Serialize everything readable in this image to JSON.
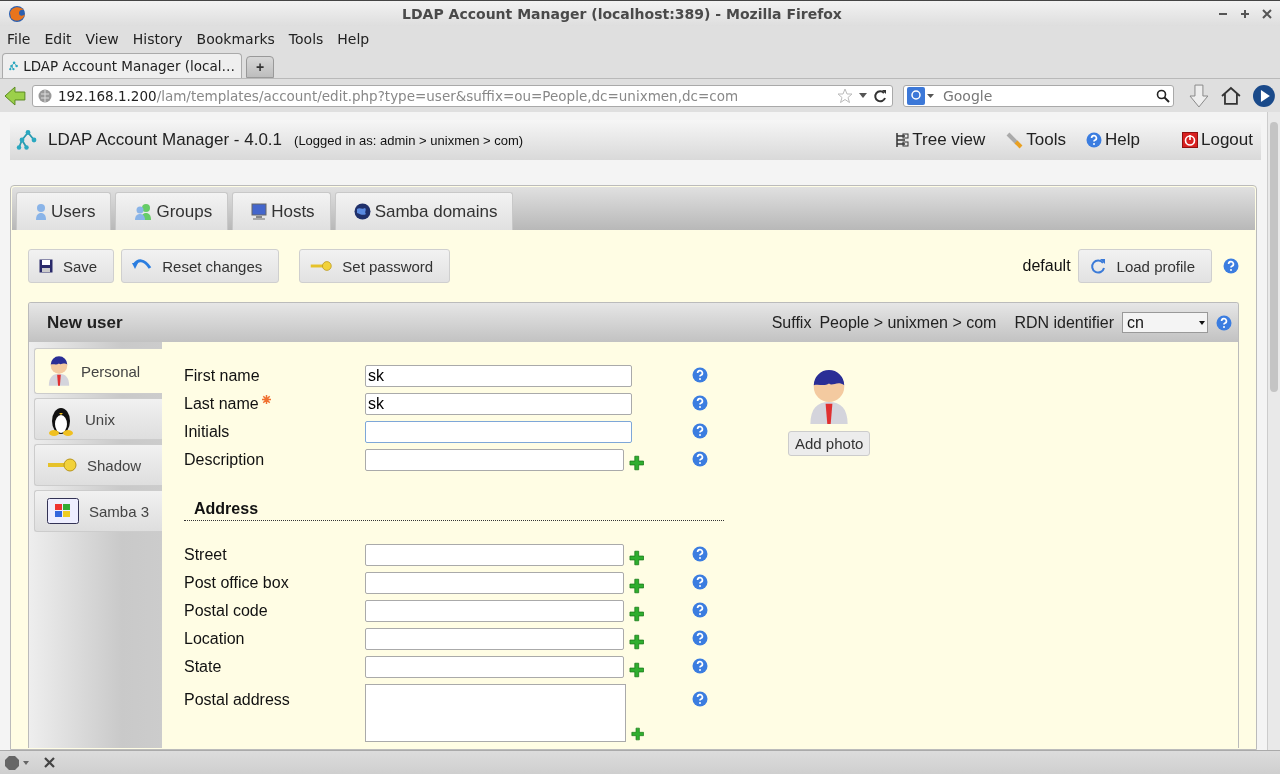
{
  "window": {
    "title": "LDAP Account Manager (localhost:389) - Mozilla Firefox"
  },
  "menu": [
    "File",
    "Edit",
    "View",
    "History",
    "Bookmarks",
    "Tools",
    "Help"
  ],
  "browser_tabs": [
    {
      "label": "LDAP Account Manager (local…",
      "selected": true
    }
  ],
  "new_tab": "+",
  "address_bar": {
    "host": "192.168.1.200",
    "path": "/lam/templates/account/edit.php?type=user&suffix=ou=People,dc=unixmen,dc=com"
  },
  "search": {
    "placeholder": "Google"
  },
  "app_header": {
    "title": "LDAP Account Manager - 4.0.1",
    "login": "(Logged in as: admin > unixmen > com)",
    "links": [
      "Tree view",
      "Tools",
      "Help",
      "Logout"
    ]
  },
  "type_tabs": [
    "Users",
    "Groups",
    "Hosts",
    "Samba domains"
  ],
  "actions": [
    "Save",
    "Reset changes",
    "Set password"
  ],
  "profile": {
    "name": "default",
    "button": "Load profile"
  },
  "account": {
    "title": "New user",
    "suffix_label": "Suffix",
    "suffix": "People > unixmen > com",
    "rdn_label": "RDN identifier",
    "rdn_value": "cn"
  },
  "modules": [
    {
      "label": "Personal",
      "selected": true
    },
    {
      "label": "Unix",
      "selected": false
    },
    {
      "label": "Shadow",
      "selected": false
    },
    {
      "label": "Samba 3",
      "selected": false
    }
  ],
  "sections": [
    {
      "fields": [
        {
          "kind": "text",
          "label": "First name",
          "value": "sk",
          "required": false,
          "focused": false,
          "addable": false
        },
        {
          "kind": "text",
          "label": "Last name",
          "value": "sk",
          "required": true,
          "focused": false,
          "addable": false
        },
        {
          "kind": "text",
          "label": "Initials",
          "required": false,
          "focused": true,
          "addable": false
        },
        {
          "kind": "text",
          "label": "Description",
          "required": false,
          "focused": false,
          "addable": true
        }
      ]
    },
    {
      "heading": "Address",
      "fields": [
        {
          "kind": "text",
          "label": "Street",
          "required": false,
          "focused": false,
          "addable": true
        },
        {
          "kind": "text",
          "label": "Post office box",
          "required": false,
          "focused": false,
          "addable": true
        },
        {
          "kind": "text",
          "label": "Postal code",
          "required": false,
          "focused": false,
          "addable": true
        },
        {
          "kind": "text",
          "label": "Location",
          "required": false,
          "focused": false,
          "addable": true
        },
        {
          "kind": "text",
          "label": "State",
          "required": false,
          "focused": false,
          "addable": true
        },
        {
          "kind": "textarea",
          "label": "Postal address",
          "required": false,
          "focused": false,
          "addable": true
        }
      ]
    }
  ],
  "photo": {
    "button": "Add photo"
  }
}
